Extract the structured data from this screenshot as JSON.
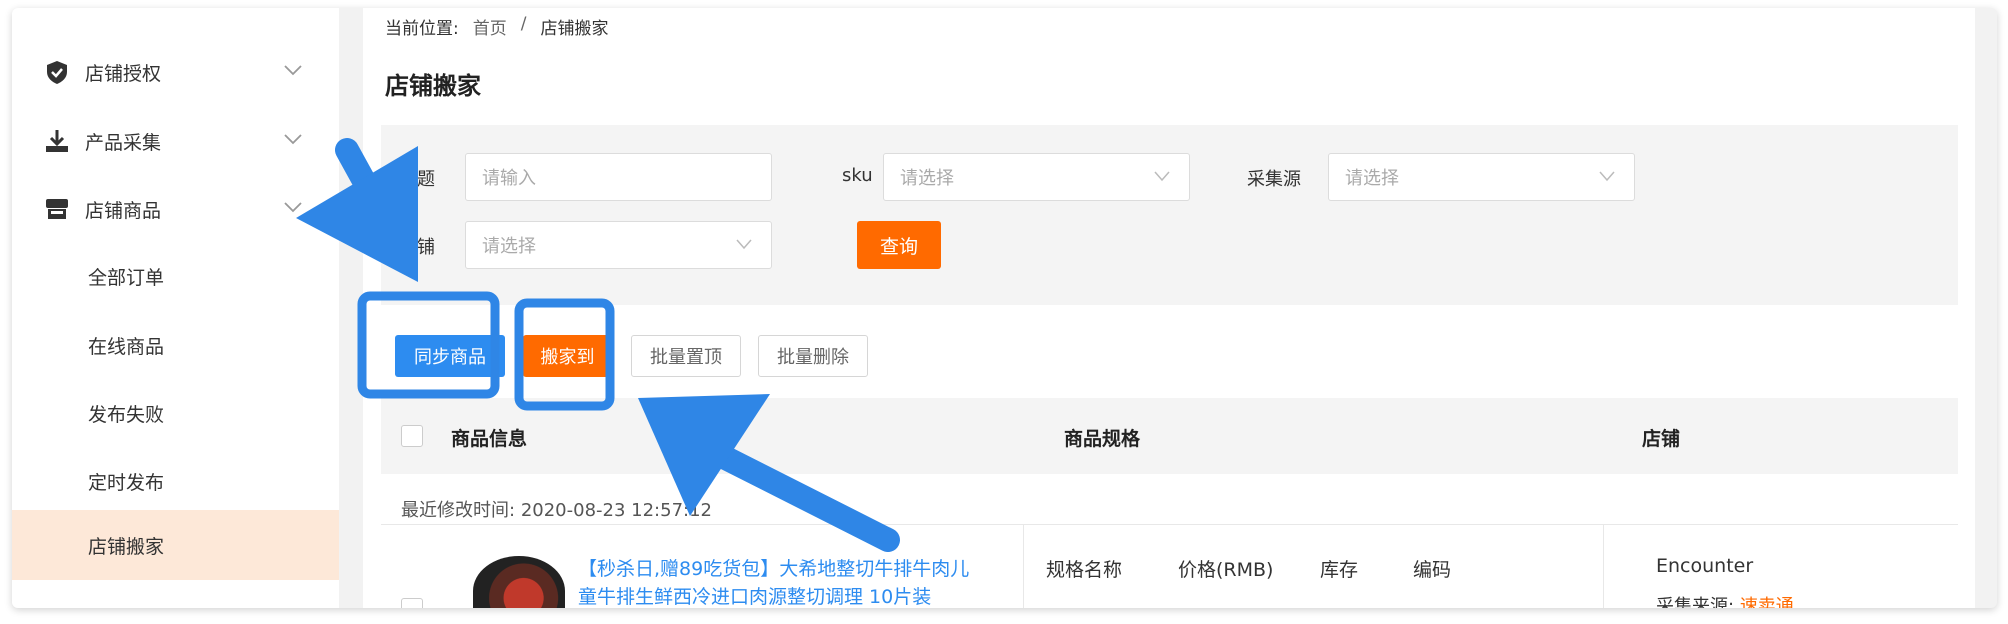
{
  "breadcrumb": {
    "label": "当前位置:",
    "home": "首页",
    "separator": "/",
    "current": "店铺搬家"
  },
  "page_title": "店铺搬家",
  "sidebar": {
    "groups": [
      {
        "label": "店铺授权",
        "icon": "shield-check-icon"
      },
      {
        "label": "产品采集",
        "icon": "download-icon"
      },
      {
        "label": "店铺商品",
        "icon": "store-icon"
      }
    ],
    "sub_items": [
      "全部订单",
      "在线商品",
      "发布失败",
      "定时发布",
      "店铺搬家"
    ],
    "active": "店铺搬家"
  },
  "filters": {
    "title_label": "标题",
    "title_placeholder": "请输入",
    "sku_label": "sku",
    "sku_placeholder": "请选择",
    "source_label": "采集源",
    "source_placeholder": "请选择",
    "shop_label": "店铺",
    "shop_placeholder": "请选择",
    "query_button": "查询"
  },
  "toolbar": {
    "sync_button": "同步商品",
    "move_button": "搬家到",
    "pin_button": "批量置顶",
    "delete_button": "批量删除"
  },
  "table": {
    "headers": [
      "商品信息",
      "商品规格",
      "店铺"
    ],
    "modified_label": "最近修改时间:",
    "modified_value": "2020-08-23 12:57:12",
    "row": {
      "title": "【秒杀日,赠89吃货包】大希地整切牛排牛肉儿童牛排生鲜西冷进口肉源整切调理 10片装",
      "spec_headers": [
        "规格名称",
        "价格(RMB)",
        "库存",
        "编码"
      ],
      "shop": "Encounter",
      "source_label": "采集来源:",
      "source_value": "速卖通"
    }
  },
  "colors": {
    "accent_orange": "#ff6a00",
    "primary_blue": "#2d8cf0",
    "annotation_blue": "#2f86e6",
    "sidebar_active_bg": "#fde8d8"
  }
}
